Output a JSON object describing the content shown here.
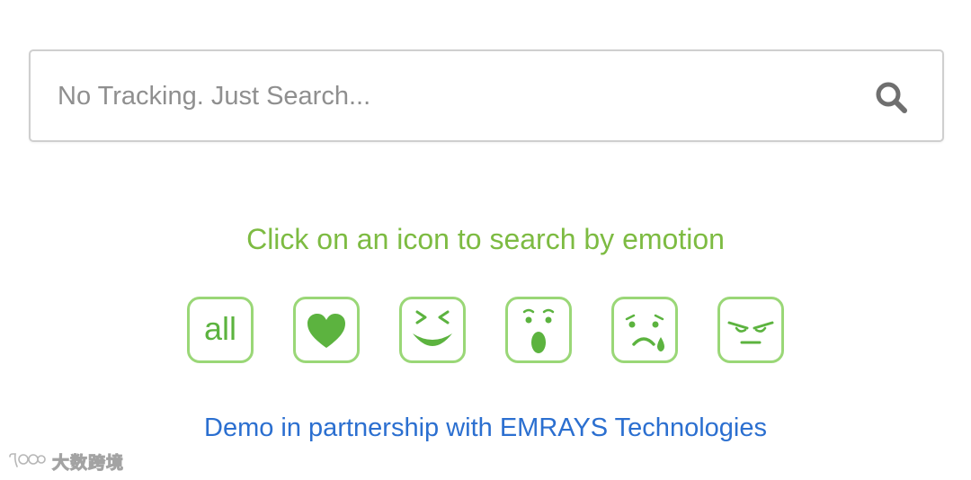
{
  "search": {
    "placeholder": "No Tracking. Just Search...",
    "value": "",
    "button_icon": "search-icon"
  },
  "emotion_prompt": "Click on an icon to search by emotion",
  "emotions": [
    {
      "id": "all",
      "label": "all",
      "icon": "all-text"
    },
    {
      "id": "love",
      "label": "",
      "icon": "heart-icon"
    },
    {
      "id": "joy",
      "label": "",
      "icon": "laughing-face-icon"
    },
    {
      "id": "surprise",
      "label": "",
      "icon": "surprised-face-icon"
    },
    {
      "id": "sadness",
      "label": "",
      "icon": "crying-face-icon"
    },
    {
      "id": "anger",
      "label": "",
      "icon": "angry-face-icon"
    }
  ],
  "partner_link": "Demo in partnership with EMRAYS Technologies",
  "watermark": {
    "text": "大数跨境",
    "icon": "watermark-logo-icon"
  },
  "colors": {
    "accent_green": "#7dbb42",
    "icon_green": "#5cb33f",
    "icon_border": "#9ad777",
    "link_blue": "#2b6fd0",
    "placeholder_gray": "#8f8f8f"
  }
}
